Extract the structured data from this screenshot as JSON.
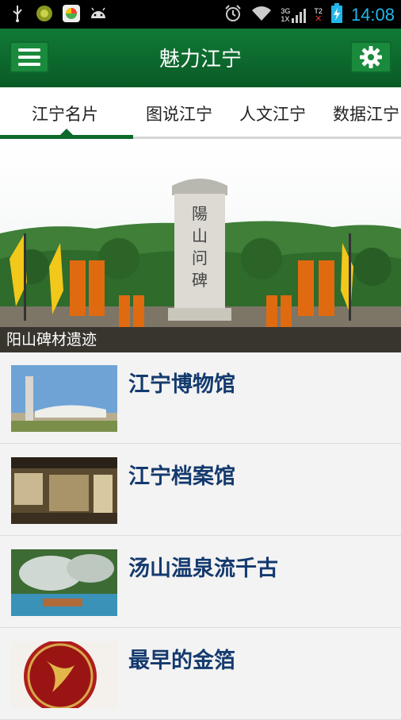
{
  "status_bar": {
    "time": "14:08",
    "net_top": "3G",
    "net_bottom": "1X",
    "sim_label": "T2"
  },
  "app_bar": {
    "title": "魅力江宁"
  },
  "tabs": [
    {
      "label": "江宁名片",
      "selected": true
    },
    {
      "label": "图说江宁",
      "selected": false
    },
    {
      "label": "人文江宁",
      "selected": false
    },
    {
      "label": "数据江宁",
      "selected": false
    }
  ],
  "hero": {
    "caption": "阳山碑材遗迹",
    "monument_text": "陽山问碑"
  },
  "list": [
    {
      "title": "江宁博物馆"
    },
    {
      "title": "江宁档案馆"
    },
    {
      "title": "汤山温泉流千古"
    },
    {
      "title": "最早的金箔"
    }
  ],
  "colors": {
    "accent": "#0d6a2c",
    "title_blue": "#143a6e",
    "clock": "#21b7ea"
  }
}
